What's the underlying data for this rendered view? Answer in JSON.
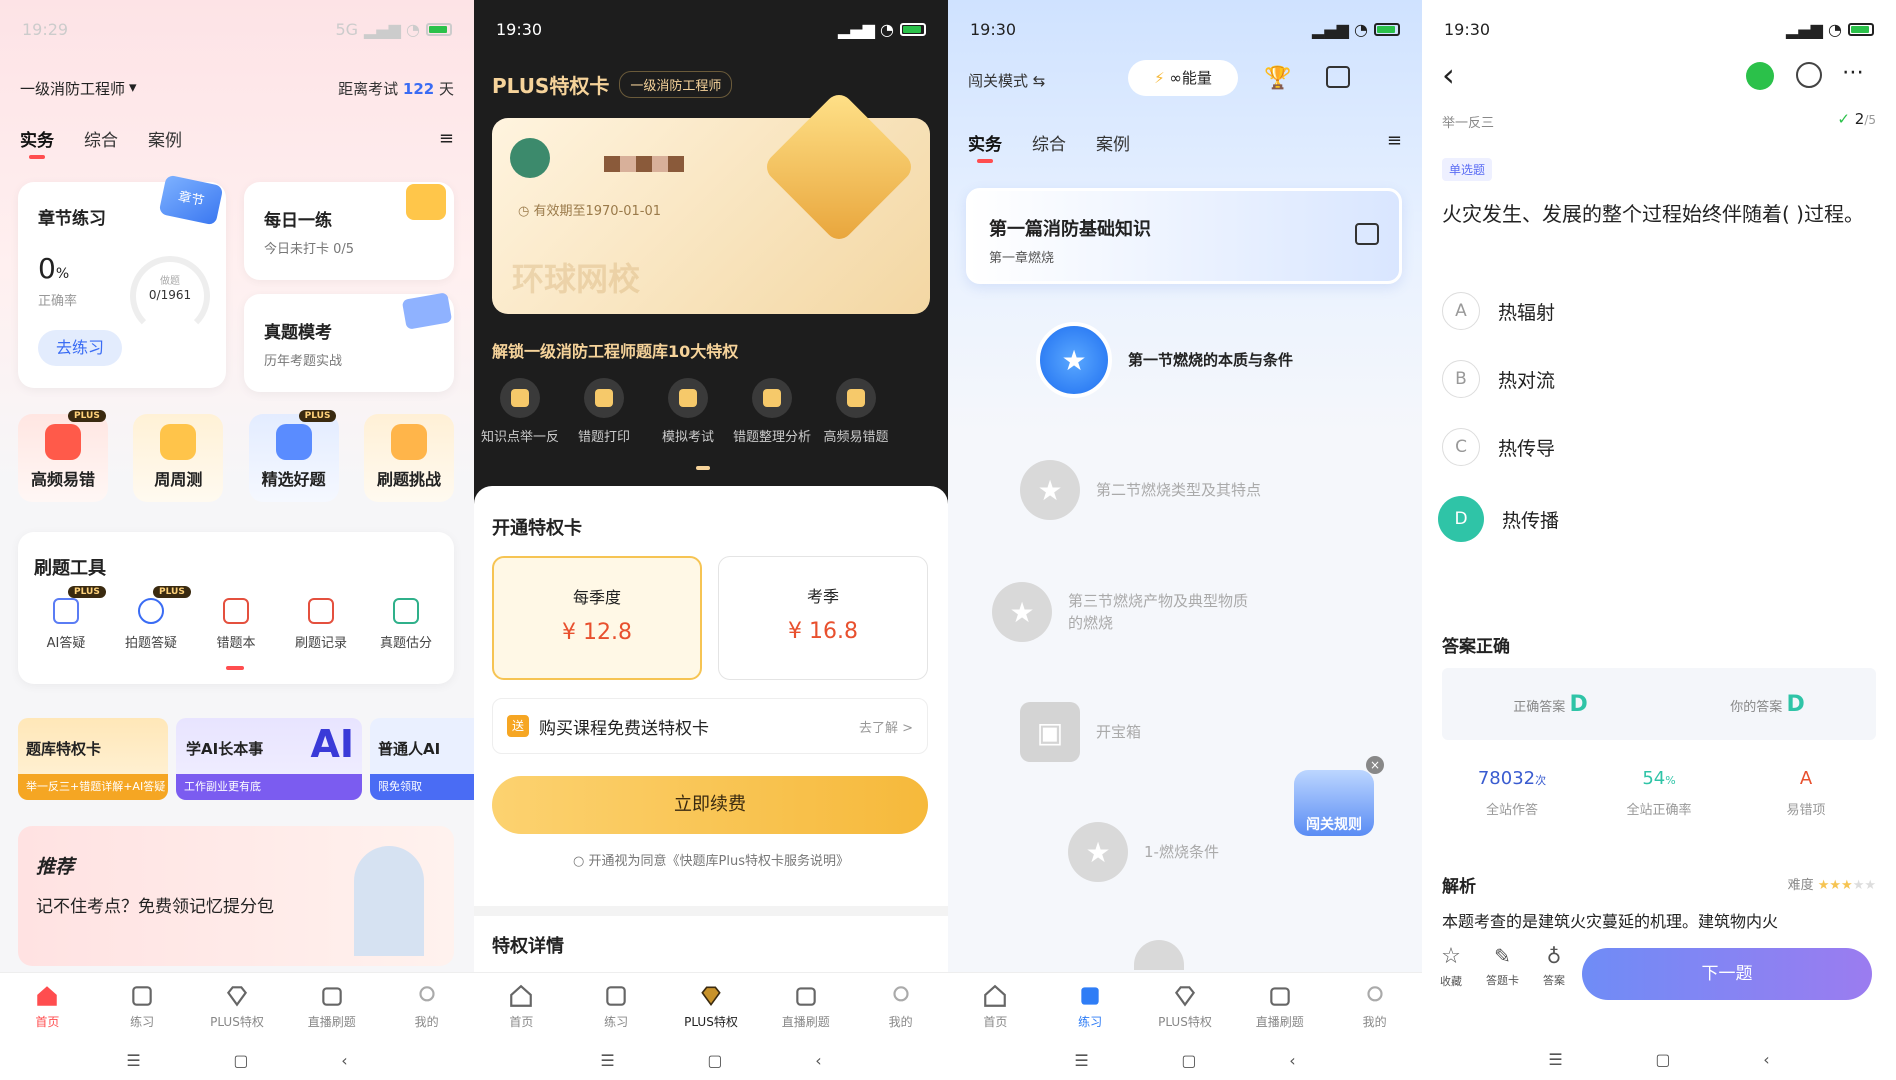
{
  "status": {
    "time1": "19:29",
    "time": "19:30",
    "battery": "78",
    "net": "5G"
  },
  "p1": {
    "exam": "一级消防工程师",
    "countdown_prefix": "距离考试",
    "countdown_days": "122",
    "countdown_unit": "天",
    "tabs": [
      "实务",
      "综合",
      "案例"
    ],
    "chapter": {
      "title": "章节练习",
      "badge": "章节",
      "rate": "0",
      "rate_unit": "%",
      "rate_label": "正确率",
      "done_label": "做题",
      "done": "0/1961",
      "btn": "去练习"
    },
    "daily": {
      "title": "每日一练",
      "sub": "今日未打卡 0/5"
    },
    "mock": {
      "title": "真题模考",
      "sub": "历年考题实战"
    },
    "grid": [
      "高频易错",
      "周周测",
      "精选好题",
      "刷题挑战"
    ],
    "plus_tag": "PLUS",
    "tools": {
      "title": "刷题工具",
      "items": [
        "AI答疑",
        "拍题答疑",
        "错题本",
        "刷题记录",
        "真题估分"
      ]
    },
    "banners": [
      {
        "title": "题库特权卡",
        "sub": "举一反三+错题详解+AI答疑"
      },
      {
        "title": "学AI长本事",
        "sub": "工作副业更有底",
        "logo": "AI"
      },
      {
        "title": "普通人AI",
        "sub": "限免领取"
      }
    ],
    "recommend": {
      "title": "推荐",
      "text": "记不住考点？免费领记忆提分包"
    }
  },
  "p2": {
    "title": "PLUS特权卡",
    "exam": "一级消防工程师",
    "valid": "有效期至1970-01-01",
    "watermark": "环球网校",
    "unlock": "解锁一级消防工程师题库10大特权",
    "privileges": [
      "知识点举一反",
      "错题打印",
      "模拟考试",
      "错题整理分析",
      "高频易错题"
    ],
    "open_title": "开通特权卡",
    "plans": [
      {
        "name": "每季度",
        "price": "¥ 12.8"
      },
      {
        "name": "考季",
        "price": "¥ 16.8"
      }
    ],
    "gift": {
      "icon": "送",
      "text": "购买课程免费送特权卡",
      "link": "去了解 >"
    },
    "renew": "立即续费",
    "agree": "开通视为同意《快题库Plus特权卡服务说明》",
    "detail": "特权详情"
  },
  "p3": {
    "mode": "闯关模式 ⇆",
    "energy": "∞能量",
    "tabs": [
      "实务",
      "综合",
      "案例"
    ],
    "chapter": {
      "title": "第一篇消防基础知识",
      "sub": "第一章燃烧"
    },
    "nodes": [
      "第一节燃烧的本质与条件",
      "第二节燃烧类型及其特点",
      "第三节燃烧产物及典型物质的燃烧",
      "开宝箱",
      "1-燃烧条件"
    ],
    "rules": "闯关规则"
  },
  "p4": {
    "crumb": "举一反三",
    "progress": "2",
    "progress_total": "/5",
    "type": "单选题",
    "question": "火灾发生、发展的整个过程始终伴随着(    )过程。",
    "options": [
      {
        "k": "A",
        "t": "热辐射"
      },
      {
        "k": "B",
        "t": "热对流"
      },
      {
        "k": "C",
        "t": "热传导"
      },
      {
        "k": "D",
        "t": "热传播"
      }
    ],
    "result": "答案正确",
    "correct_label": "正确答案",
    "correct": "D",
    "yours_label": "你的答案",
    "yours": "D",
    "stats": [
      {
        "v": "78032",
        "u": "次",
        "l": "全站作答"
      },
      {
        "v": "54",
        "u": "%",
        "l": "全站正确率"
      },
      {
        "v": "A",
        "u": "",
        "l": "易错项"
      }
    ],
    "analysis": "解析",
    "difficulty": "难度",
    "difficulty_stars": 3,
    "analysis_text": "本题考查的是建筑火灾蔓延的机理。建筑物内火",
    "bottom": [
      "收藏",
      "答题卡",
      "答案"
    ],
    "next": "下一题"
  },
  "nav": [
    "首页",
    "练习",
    "PLUS特权",
    "直播刷题",
    "我的"
  ],
  "colors": {
    "red": "#ff4d4f",
    "gold": "#f6c453",
    "purple": "#7b7cf0",
    "teal": "#2fc4a7",
    "blue": "#4a7cf6"
  }
}
